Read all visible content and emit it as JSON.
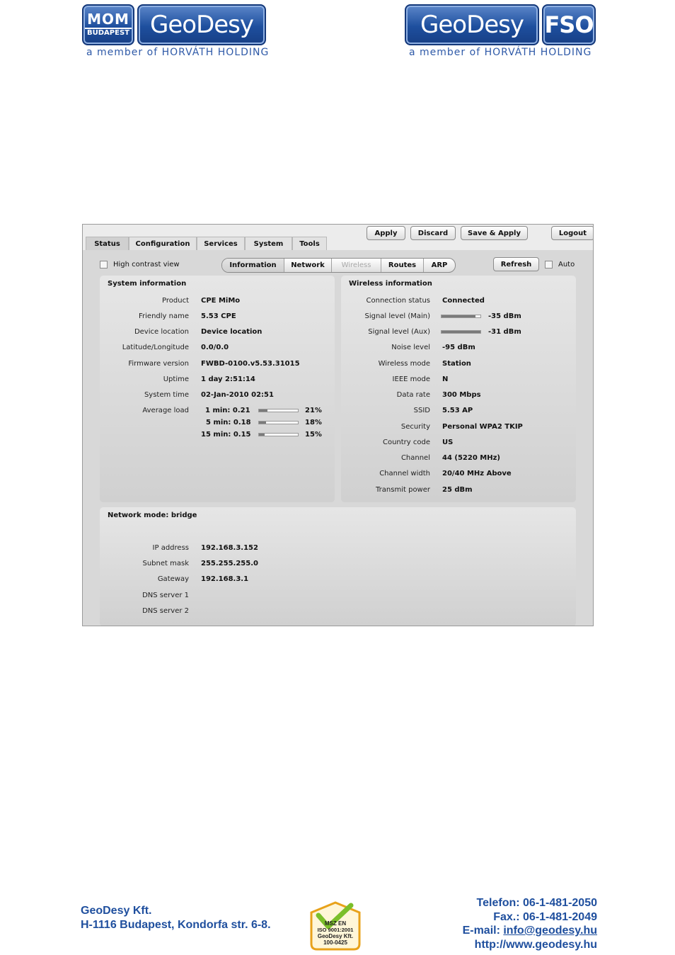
{
  "header": {
    "left_logo": {
      "mom_top": "MOM",
      "mom_bottom": "BUDAPEST",
      "name": "GeoDesy",
      "tagline": "a member of HORVÁTH HOLDING"
    },
    "right_logo": {
      "name": "GeoDesy",
      "suffix": "FSO",
      "tagline": "a member of HORVÁTH HOLDING"
    }
  },
  "ui": {
    "main_tabs": [
      {
        "label": "Status"
      },
      {
        "label": "Configuration"
      },
      {
        "label": "Services"
      },
      {
        "label": "System"
      },
      {
        "label": "Tools"
      }
    ],
    "top_buttons": {
      "apply": "Apply",
      "discard": "Discard",
      "save_apply": "Save & Apply",
      "logout": "Logout"
    },
    "high_contrast_label": "High contrast view",
    "sub_tabs": [
      {
        "label": "Information"
      },
      {
        "label": "Network"
      },
      {
        "label": "Wireless"
      },
      {
        "label": "Routes"
      },
      {
        "label": "ARP"
      }
    ],
    "refresh_label": "Refresh",
    "auto_label": "Auto",
    "system_info": {
      "title": "System information",
      "product_label": "Product",
      "product": "CPE MiMo",
      "friendly_name_label": "Friendly name",
      "friendly_name": "5.53 CPE",
      "device_location_label": "Device location",
      "device_location": "Device location",
      "latlon_label": "Latitude/Longitude",
      "latlon": "0.0/0.0",
      "firmware_label": "Firmware version",
      "firmware": "FWBD-0100.v5.53.31015",
      "uptime_label": "Uptime",
      "uptime": "1 day 2:51:14",
      "system_time_label": "System time",
      "system_time": "02-Jan-2010 02:51",
      "avg_load_label": "Average load",
      "loads": [
        {
          "label": "1 min: 0.21",
          "percent": "21%",
          "fraction": 0.21
        },
        {
          "label": "5 min: 0.18",
          "percent": "18%",
          "fraction": 0.18
        },
        {
          "label": "15 min: 0.15",
          "percent": "15%",
          "fraction": 0.15
        }
      ]
    },
    "wireless_info": {
      "title": "Wireless information",
      "connection_status_label": "Connection status",
      "connection_status": "Connected",
      "signal_main_label": "Signal level (Main)",
      "signal_main": "-35 dBm",
      "signal_main_fraction": 0.88,
      "signal_aux_label": "Signal level (Aux)",
      "signal_aux": "-31 dBm",
      "signal_aux_fraction": 1.0,
      "noise_label": "Noise level",
      "noise": "-95 dBm",
      "wireless_mode_label": "Wireless mode",
      "wireless_mode": "Station",
      "ieee_label": "IEEE mode",
      "ieee": "N",
      "data_rate_label": "Data rate",
      "data_rate": "300 Mbps",
      "ssid_label": "SSID",
      "ssid": "5.53 AP",
      "security_label": "Security",
      "security": "Personal WPA2 TKIP",
      "country_label": "Country code",
      "country": "US",
      "channel_label": "Channel",
      "channel": "44 (5220 MHz)",
      "channel_width_label": "Channel width",
      "channel_width": "20/40 MHz Above",
      "tx_power_label": "Transmit power",
      "tx_power": "25 dBm"
    },
    "network": {
      "title": "Network mode: bridge",
      "ip_label": "IP address",
      "ip": "192.168.3.152",
      "mask_label": "Subnet mask",
      "mask": "255.255.255.0",
      "gateway_label": "Gateway",
      "gateway": "192.168.3.1",
      "dns1_label": "DNS server 1",
      "dns1": "",
      "dns2_label": "DNS server 2",
      "dns2": ""
    }
  },
  "footer": {
    "company": "GeoDesy Kft.",
    "address": "H-1116 Budapest, Kondorfa str. 6-8.",
    "phone": "Telefon: 06-1-481-2050",
    "fax": "Fax.: 06-1-481-2049",
    "email_label": "E-mail: ",
    "email": "info@geodesy.hu",
    "web": "http://www.geodesy.hu",
    "iso_badge": {
      "line1": "MSZ EN",
      "line2": "ISO 9001:2001",
      "line3": "GeoDesy Kft.",
      "line4": "100-0425"
    }
  },
  "colors": {
    "brand_blue": "#1f4f9e",
    "panel_gray": "#d8d8d8",
    "badge_orange": "#e8a21a",
    "badge_green": "#7bbf2a"
  }
}
